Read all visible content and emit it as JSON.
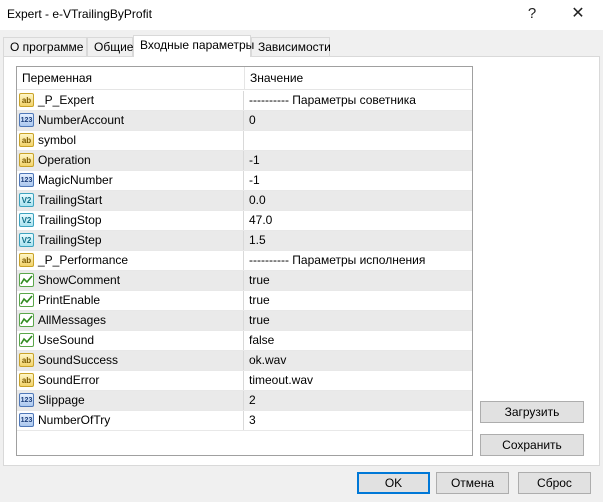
{
  "window": {
    "title": "Expert - e-VTrailingByProfit",
    "help": "?",
    "close": "✕"
  },
  "tabs": [
    {
      "label": "О программе"
    },
    {
      "label": "Общие"
    },
    {
      "label": "Входные параметры"
    },
    {
      "label": "Зависимости"
    }
  ],
  "active_tab": "Входные параметры",
  "grid": {
    "col_variable": "Переменная",
    "col_value": "Значение",
    "rows": [
      {
        "type": "string",
        "icon": "ab",
        "name": "_P_Expert",
        "value": "---------- Параметры советника"
      },
      {
        "type": "int",
        "icon": "123",
        "name": "NumberAccount",
        "value": "0"
      },
      {
        "type": "string",
        "icon": "ab",
        "name": "symbol",
        "value": ""
      },
      {
        "type": "string",
        "icon": "ab",
        "name": "Operation",
        "value": "-1"
      },
      {
        "type": "int",
        "icon": "123",
        "name": "MagicNumber",
        "value": "-1"
      },
      {
        "type": "double",
        "icon": "V2",
        "name": "TrailingStart",
        "value": "0.0"
      },
      {
        "type": "double",
        "icon": "V2",
        "name": "TrailingStop",
        "value": "47.0"
      },
      {
        "type": "double",
        "icon": "V2",
        "name": "TrailingStep",
        "value": "1.5"
      },
      {
        "type": "string",
        "icon": "ab",
        "name": "_P_Performance",
        "value": "---------- Параметры исполнения"
      },
      {
        "type": "bool",
        "icon": "chart",
        "name": "ShowComment",
        "value": "true"
      },
      {
        "type": "bool",
        "icon": "chart",
        "name": "PrintEnable",
        "value": "true"
      },
      {
        "type": "bool",
        "icon": "chart",
        "name": "AllMessages",
        "value": "true"
      },
      {
        "type": "bool",
        "icon": "chart",
        "name": "UseSound",
        "value": "false"
      },
      {
        "type": "string",
        "icon": "ab",
        "name": "SoundSuccess",
        "value": "ok.wav"
      },
      {
        "type": "string",
        "icon": "ab",
        "name": "SoundError",
        "value": "timeout.wav"
      },
      {
        "type": "int",
        "icon": "123",
        "name": "Slippage",
        "value": "2"
      },
      {
        "type": "int",
        "icon": "123",
        "name": "NumberOfTry",
        "value": "3"
      }
    ]
  },
  "buttons": {
    "load": "Загрузить",
    "save": "Сохранить",
    "ok": "OK",
    "cancel": "Отмена",
    "reset": "Сброс"
  }
}
